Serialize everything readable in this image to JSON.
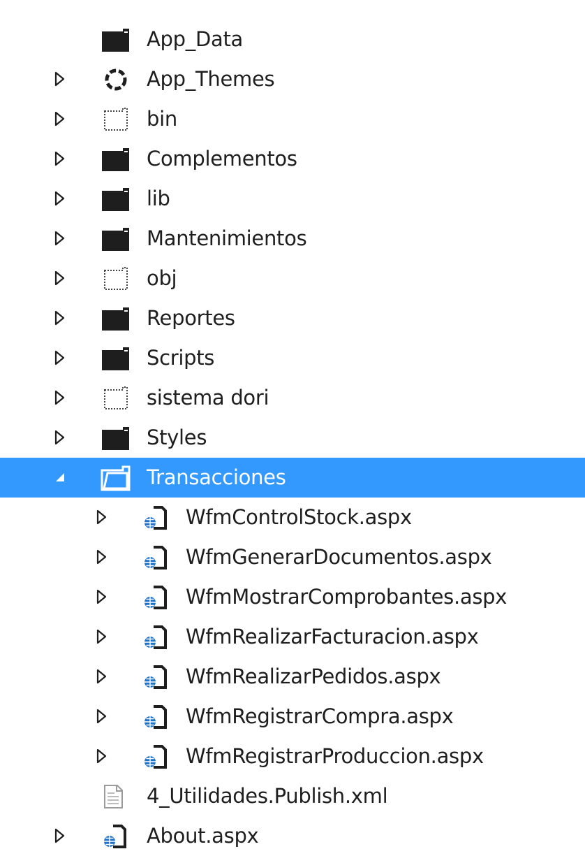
{
  "solution_explorer": {
    "items": [
      {
        "label": "App_Data",
        "icon": "folder-icon",
        "expander": "none",
        "level": 0
      },
      {
        "label": "App_Themes",
        "icon": "themes-folder-icon",
        "expander": "collapsed",
        "level": 0
      },
      {
        "label": "bin",
        "icon": "excluded-folder-icon",
        "expander": "collapsed",
        "level": 0
      },
      {
        "label": "Complementos",
        "icon": "folder-icon",
        "expander": "collapsed",
        "level": 0
      },
      {
        "label": "lib",
        "icon": "folder-icon",
        "expander": "collapsed",
        "level": 0
      },
      {
        "label": "Mantenimientos",
        "icon": "folder-icon",
        "expander": "collapsed",
        "level": 0
      },
      {
        "label": "obj",
        "icon": "excluded-folder-icon",
        "expander": "collapsed",
        "level": 0
      },
      {
        "label": "Reportes",
        "icon": "folder-icon",
        "expander": "collapsed",
        "level": 0
      },
      {
        "label": "Scripts",
        "icon": "folder-icon",
        "expander": "collapsed",
        "level": 0
      },
      {
        "label": "sistema dori",
        "icon": "excluded-folder-icon",
        "expander": "collapsed",
        "level": 0
      },
      {
        "label": "Styles",
        "icon": "folder-icon",
        "expander": "collapsed",
        "level": 0
      },
      {
        "label": "Transacciones",
        "icon": "open-folder-icon",
        "expander": "expanded",
        "level": 0,
        "selected": true
      },
      {
        "label": "WfmControlStock.aspx",
        "icon": "aspx-file-icon",
        "expander": "collapsed",
        "level": 1
      },
      {
        "label": "WfmGenerarDocumentos.aspx",
        "icon": "aspx-file-icon",
        "expander": "collapsed",
        "level": 1
      },
      {
        "label": "WfmMostrarComprobantes.aspx",
        "icon": "aspx-file-icon",
        "expander": "collapsed",
        "level": 1
      },
      {
        "label": "WfmRealizarFacturacion.aspx",
        "icon": "aspx-file-icon",
        "expander": "collapsed",
        "level": 1
      },
      {
        "label": "WfmRealizarPedidos.aspx",
        "icon": "aspx-file-icon",
        "expander": "collapsed",
        "level": 1
      },
      {
        "label": "WfmRegistrarCompra.aspx",
        "icon": "aspx-file-icon",
        "expander": "collapsed",
        "level": 1
      },
      {
        "label": "WfmRegistrarProduccion.aspx",
        "icon": "aspx-file-icon",
        "expander": "collapsed",
        "level": 1
      },
      {
        "label": "4_Utilidades.Publish.xml",
        "icon": "xml-file-icon",
        "expander": "none",
        "level": 0
      },
      {
        "label": "About.aspx",
        "icon": "aspx-file-icon",
        "expander": "collapsed",
        "level": 0
      }
    ]
  },
  "colors": {
    "selection": "#3399ff",
    "text": "#1e1e1e",
    "selected_text": "#ffffff",
    "globe": "#1e73c8"
  }
}
